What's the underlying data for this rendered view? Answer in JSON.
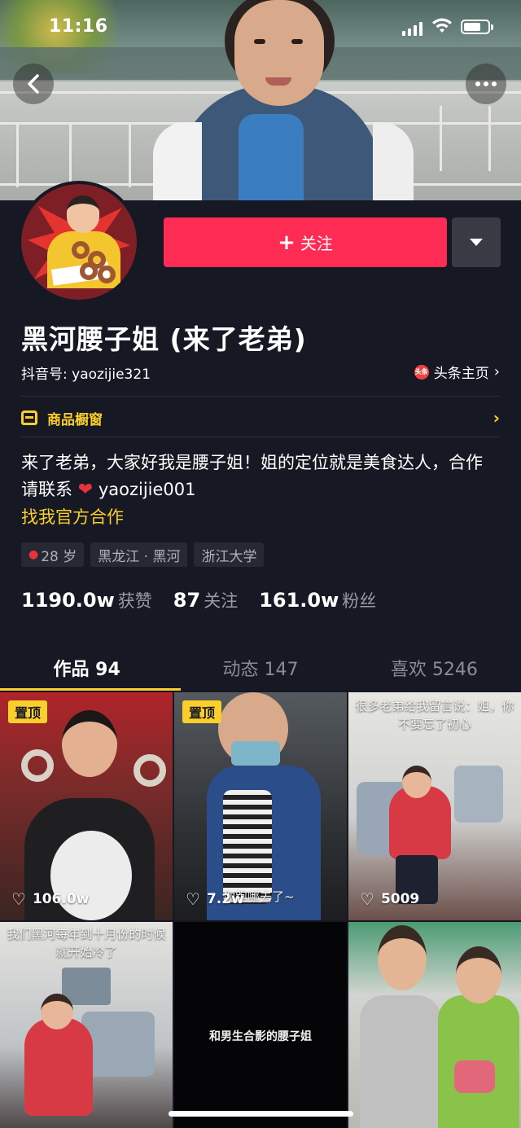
{
  "status_bar": {
    "time": "11:16"
  },
  "header": {
    "back_icon": "chevron-left-icon",
    "more_icon": "more-dots-icon"
  },
  "profile": {
    "follow_label": "关注",
    "name": "黑河腰子姐 (来了老弟)",
    "douyin_id_label": "抖音号: yaozijie321",
    "toutiao_badge": "头条",
    "toutiao_link": "头条主页",
    "shop_label": "商品橱窗",
    "bio_line": "来了老弟，大家好我是腰子姐！姐的定位就是美食达人，合作请联系",
    "bio_contact": "yaozijie001",
    "cooperation": "找我官方合作",
    "tags": {
      "age": "28 岁",
      "location": "黑龙江 · 黑河",
      "school": "浙江大学"
    },
    "stats": {
      "likes_num": "1190.0w",
      "likes_label": "获赞",
      "following_num": "87",
      "following_label": "关注",
      "fans_num": "161.0w",
      "fans_label": "粉丝"
    }
  },
  "tabs": [
    {
      "label": "作品 94"
    },
    {
      "label": "动态 147"
    },
    {
      "label": "喜欢 5246"
    }
  ],
  "videos": [
    {
      "badge": "置顶",
      "likes": "106.0w",
      "caption": ""
    },
    {
      "badge": "置顶",
      "likes": "7.2w",
      "caption": "你跑哪去了~"
    },
    {
      "badge": "",
      "likes": "5009",
      "caption": "很多老弟给我留言说：姐，你不要忘了初心"
    },
    {
      "badge": "",
      "likes": "",
      "caption": "我们黑河每年到十月份的时候就开始冷了"
    },
    {
      "badge": "",
      "likes": "",
      "caption": "和男生合影的腰子姐"
    },
    {
      "badge": "",
      "likes": "",
      "caption": ""
    }
  ],
  "colors": {
    "accent": "#fe2c55",
    "highlight": "#facf2c",
    "background": "#161823"
  }
}
